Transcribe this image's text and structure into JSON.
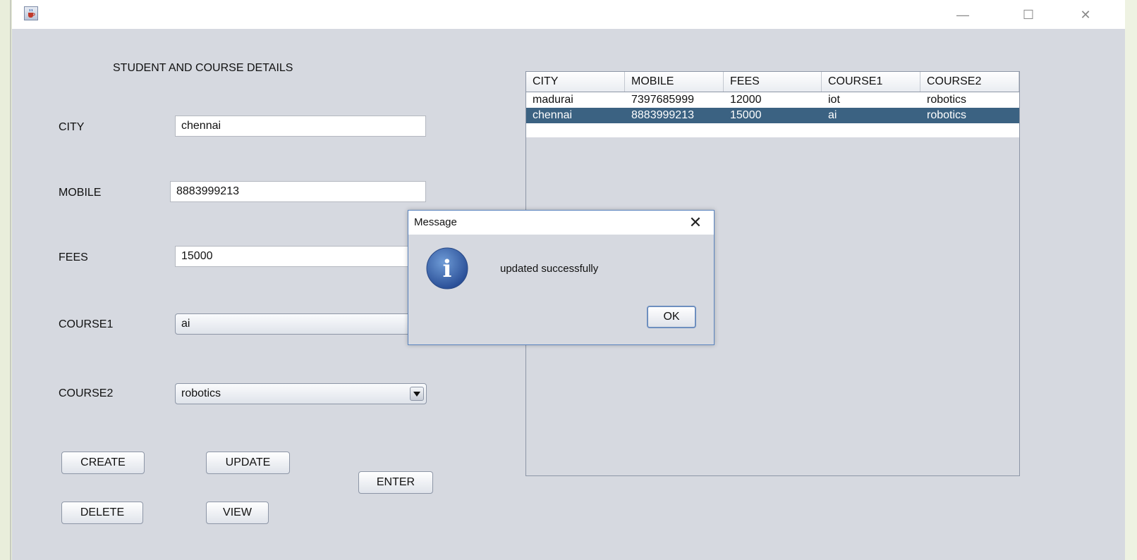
{
  "window": {
    "minimize_glyph": "—",
    "maximize_glyph": "☐",
    "close_glyph": "✕",
    "icon": "java-cup-icon"
  },
  "form": {
    "heading": "STUDENT AND COURSE DETAILS",
    "city_label": "CITY",
    "city_value": "chennai",
    "mobile_label": "MOBILE",
    "mobile_value": "8883999213",
    "fees_label": "FEES",
    "fees_value": "15000",
    "course1_label": "COURSE1",
    "course1_value": "ai",
    "course2_label": "COURSE2",
    "course2_value": "robotics"
  },
  "buttons": {
    "create": "CREATE",
    "update": "UPDATE",
    "enter": "ENTER",
    "delete": "DELETE",
    "view": "VIEW"
  },
  "table": {
    "columns": [
      "CITY",
      "MOBILE",
      "FEES",
      "COURSE1",
      "COURSE2"
    ],
    "rows": [
      [
        "madurai",
        "7397685999",
        "12000",
        "iot",
        "robotics"
      ],
      [
        "chennai",
        "8883999213",
        "15000",
        "ai",
        "robotics"
      ]
    ],
    "selected_row": 1
  },
  "dialog": {
    "title": "Message",
    "message": "updated successfully",
    "ok_label": "OK",
    "close_glyph": "✕",
    "icon": "info-icon",
    "icon_letter": "i"
  },
  "colors": {
    "selection": "#3b6282",
    "window_bg": "#d6d9e0",
    "dialog_border": "#5a84bf"
  }
}
